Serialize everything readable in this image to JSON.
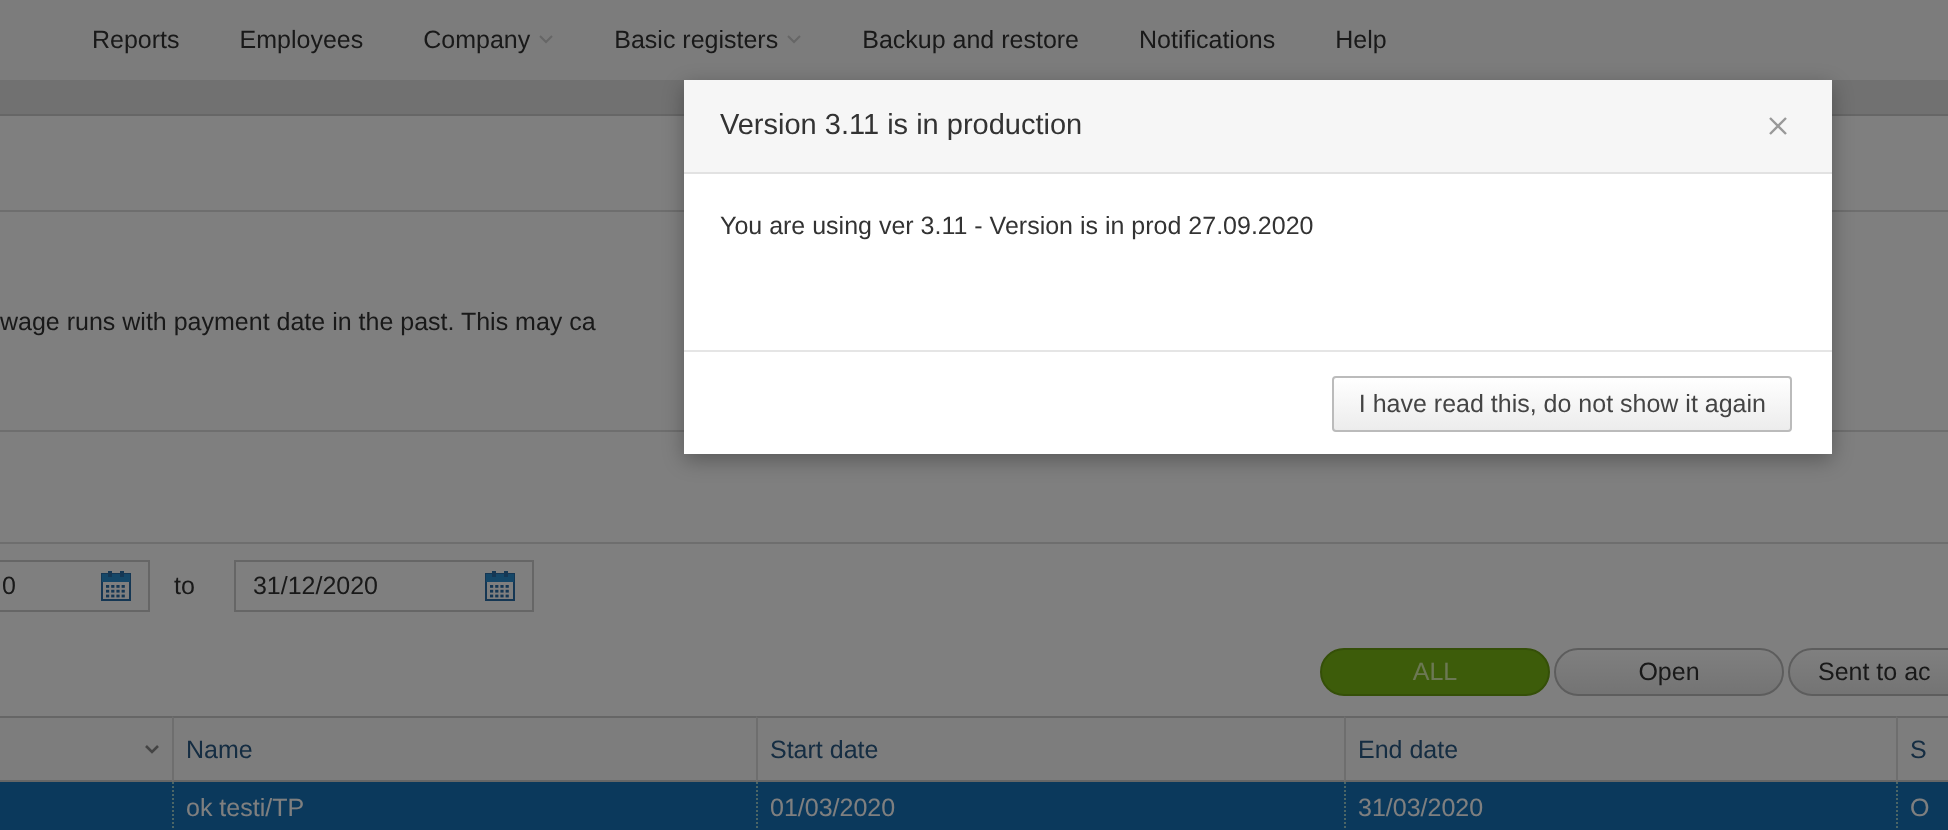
{
  "menu": [
    {
      "label": "Reports",
      "has_menu": false
    },
    {
      "label": "Employees",
      "has_menu": false
    },
    {
      "label": "Company",
      "has_menu": true
    },
    {
      "label": "Basic registers",
      "has_menu": true
    },
    {
      "label": "Backup and restore",
      "has_menu": false
    },
    {
      "label": "Notifications",
      "has_menu": false
    },
    {
      "label": "Help",
      "has_menu": false
    }
  ],
  "warning": "wage runs with payment date in the past. This may ca",
  "date_range": {
    "from": "0",
    "separator": "to",
    "to": "31/12/2020"
  },
  "filters": [
    {
      "label": "ALL",
      "selected": true
    },
    {
      "label": "Open",
      "selected": false
    },
    {
      "label": "Sent to ac",
      "selected": false
    }
  ],
  "table": {
    "columns": [
      "Name",
      "Start date",
      "End date",
      "S"
    ],
    "rows": [
      {
        "cells": [
          "ok testi/TP",
          "01/03/2020",
          "31/03/2020",
          "O"
        ],
        "selected": true
      }
    ]
  },
  "dialog": {
    "title": "Version 3.11 is in production",
    "message": "You are using ver 3.11 - Version is in prod 27.09.2020",
    "button": "I have read this, do not show it again"
  }
}
